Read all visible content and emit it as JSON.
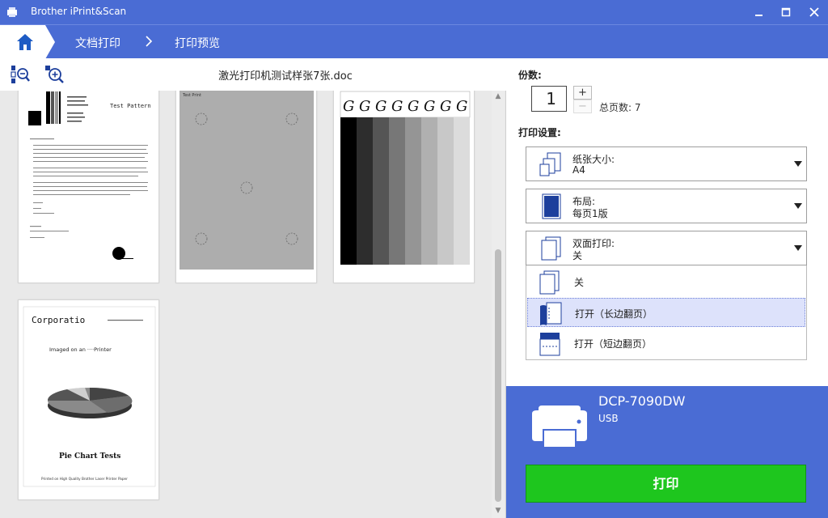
{
  "window": {
    "title": "Brother iPrint&Scan",
    "minimize_icon": "minimize-icon",
    "maximize_icon": "maximize-icon",
    "close_icon": "close-icon"
  },
  "nav": {
    "home_icon": "home-icon",
    "crumbs": [
      "文档打印",
      "打印预览"
    ]
  },
  "preview": {
    "filename": "激光打印机测试样张7张.doc",
    "zoom_out_icon": "zoom-out-icon",
    "zoom_in_icon": "zoom-in-icon",
    "page1": {
      "title": "Test Pattern"
    },
    "page2": {
      "title": "Test Print"
    },
    "page3": {
      "glyph": "G"
    },
    "page4": {
      "title": "Corporatio",
      "subtitle": "Imaged on an ····Printer",
      "chart_title": "Pie Chart Tests",
      "footer": "Printed on High Quality Brother Laser Printer Paper"
    }
  },
  "settings": {
    "copies_label": "份数:",
    "copies_value": "1",
    "plus": "+",
    "minus": "−",
    "total_pages": "总页数: 7",
    "print_settings_label": "打印设置:",
    "paper_size": {
      "label": "纸张大小:",
      "value": "A4"
    },
    "layout": {
      "label": "布局:",
      "value": "每页1版"
    },
    "duplex": {
      "label": "双面打印:",
      "value": "关",
      "options": [
        "关",
        "打开（长边翻页）",
        "打开（短边翻页）"
      ],
      "highlighted": "打开（长边翻页）"
    }
  },
  "printer": {
    "name": "DCP-7090DW",
    "connection": "USB",
    "print_button": "打印"
  },
  "colors": {
    "brand_blue": "#4a6cd4",
    "print_green": "#1ec61e",
    "highlight": "#dde2fb"
  }
}
